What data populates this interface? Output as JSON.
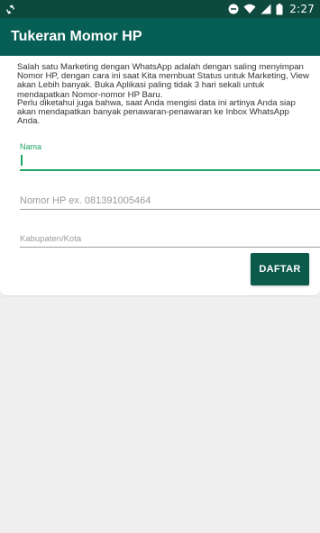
{
  "status_bar": {
    "time": "2:27",
    "icons": [
      "sync-icon",
      "do-not-disturb-icon",
      "wifi-icon",
      "signal-icon",
      "battery-icon"
    ]
  },
  "app_bar": {
    "title": "Tukeran Momor HP"
  },
  "content": {
    "description_1": "Salah satu Marketing dengan WhatsApp adalah dengan saling menyimpan Nomor HP, dengan cara ini saat Kita membuat Status untuk Marketing, View akan Lebih banyak. Buka Aplikasi paling tidak 3 hari sekali untuk mendapatkan Nomor-nomor HP Baru.",
    "description_2": "Perlu diketahui juga bahwa, saat Anda mengisi data ini artinya Anda siap akan mendapatkan banyak penawaran-penawaran ke Inbox WhatsApp Anda."
  },
  "form": {
    "name_label": "Nama",
    "name_value": "",
    "phone_placeholder": "Nomor HP ex. 081391005464",
    "city_placeholder": "Kabupaten/Kota",
    "submit_label": "DAFTAR"
  },
  "colors": {
    "status_bar": "#0d4a3d",
    "app_bar": "#075e54",
    "accent": "#1fa463",
    "button": "#0b5a4c",
    "background": "#efefef"
  }
}
